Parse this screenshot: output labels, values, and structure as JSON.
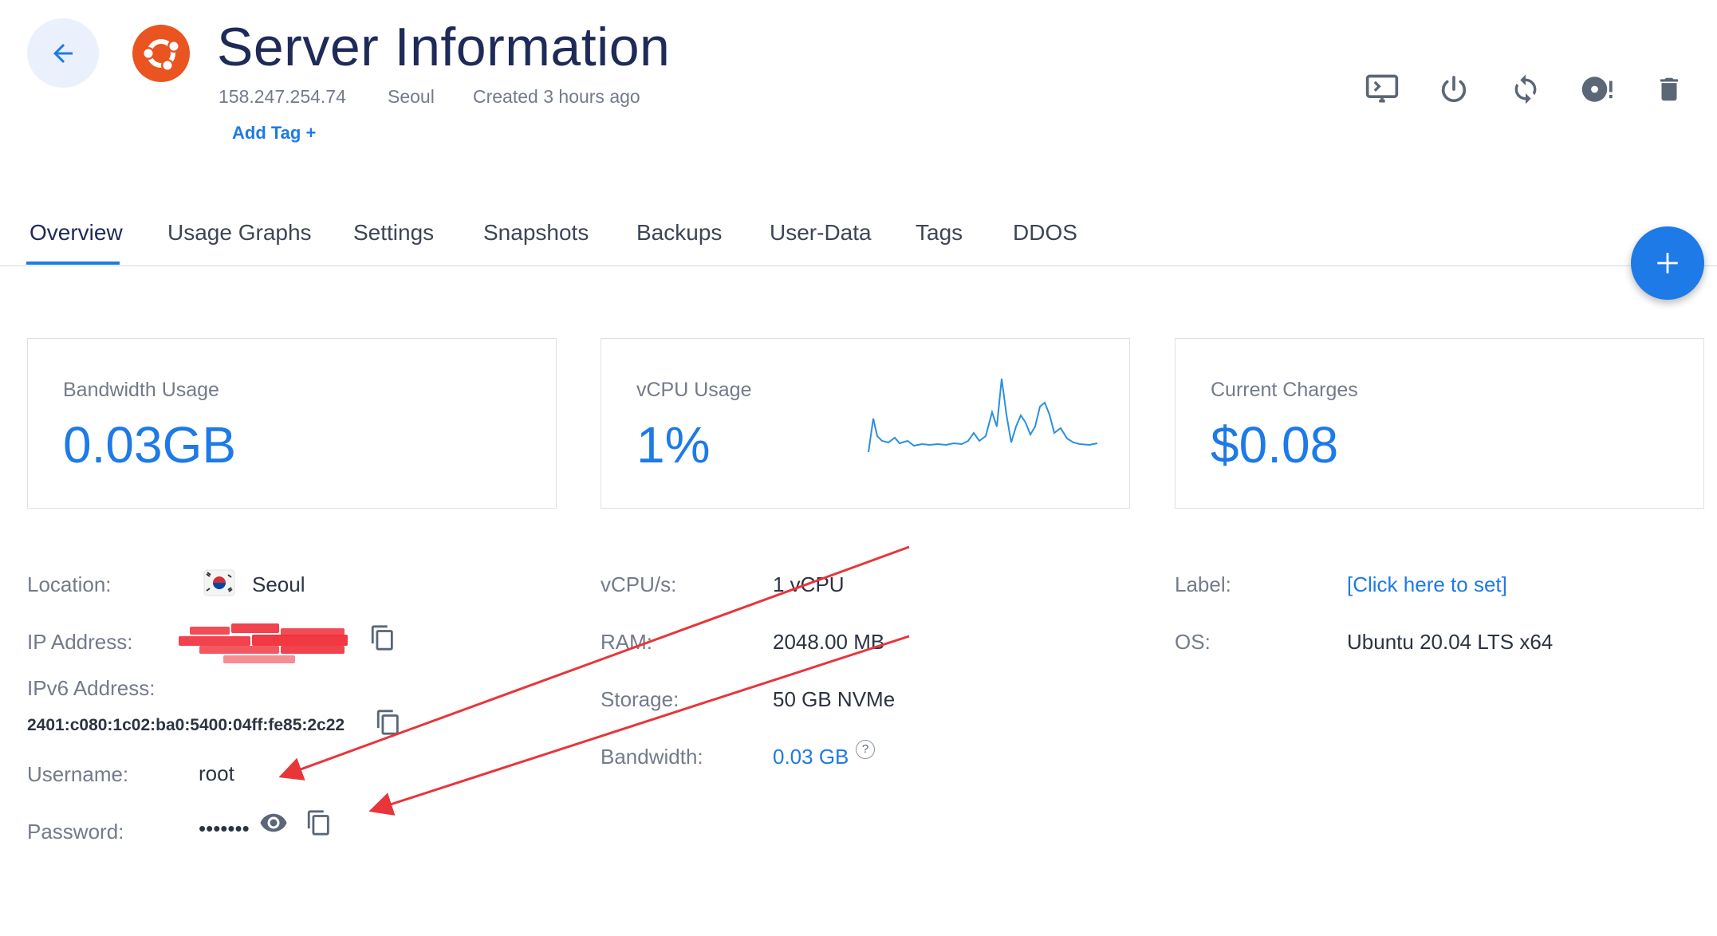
{
  "header": {
    "title": "Server Information",
    "ip": "158.247.254.74",
    "location": "Seoul",
    "created": "Created 3 hours ago",
    "add_tag": "Add Tag +"
  },
  "actions": [
    "console-icon",
    "power-icon",
    "restart-icon",
    "reinstall-icon",
    "trash-icon"
  ],
  "tabs": [
    "Overview",
    "Usage Graphs",
    "Settings",
    "Snapshots",
    "Backups",
    "User-Data",
    "Tags",
    "DDOS"
  ],
  "cards": {
    "bandwidth": {
      "label": "Bandwidth Usage",
      "value": "0.03GB"
    },
    "vcpu": {
      "label": "vCPU Usage",
      "value": "1%"
    },
    "charges": {
      "label": "Current Charges",
      "value": "$0.08"
    }
  },
  "details": {
    "location_label": "Location:",
    "location_value": "Seoul",
    "ip_label": "IP Address:",
    "ipv6_label": "IPv6 Address:",
    "ipv6_value": "2401:c080:1c02:ba0:5400:04ff:fe85:2c22",
    "username_label": "Username:",
    "username_value": "root",
    "password_label": "Password:",
    "password_value": "•••••••",
    "vcpus_label": "vCPU/s:",
    "vcpus_value": "1 vCPU",
    "ram_label": "RAM:",
    "ram_value": "2048.00 MB",
    "storage_label": "Storage:",
    "storage_value": "50 GB NVMe",
    "bandwidth_label": "Bandwidth:",
    "bandwidth_value": "0.03 GB",
    "help_glyph": "?",
    "label_label": "Label:",
    "label_value": "[Click here to set]",
    "os_label": "OS:",
    "os_value": "Ubuntu 20.04 LTS x64"
  },
  "colors": {
    "accent": "#1e7ae6",
    "title": "#1e2a58",
    "ubuntu": "#e95420",
    "annotation": "#e8353a"
  }
}
